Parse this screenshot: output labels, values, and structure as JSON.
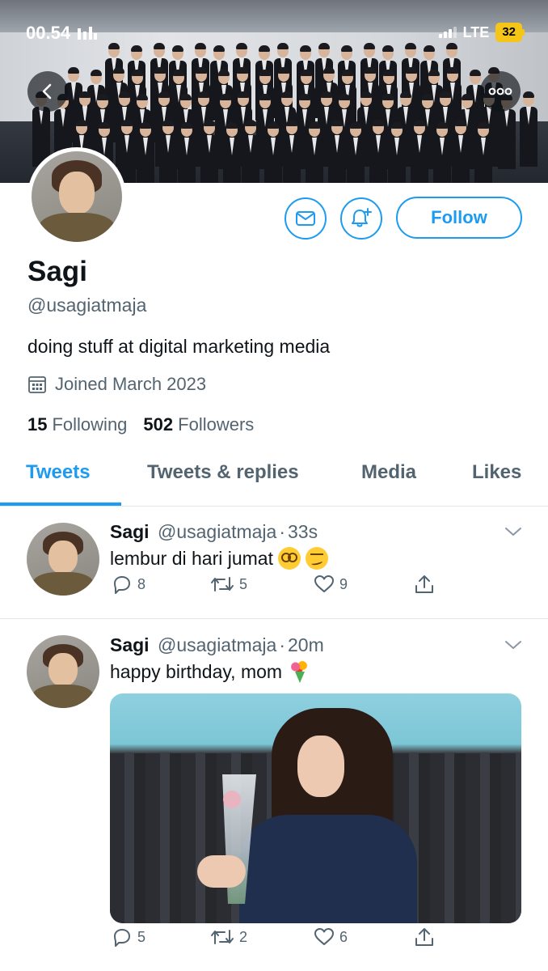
{
  "status_bar": {
    "time": "00.54",
    "network": "LTE",
    "battery": "32"
  },
  "profile": {
    "display_name": "Sagi",
    "handle": "@usagiatmaja",
    "bio": "doing stuff at digital marketing media",
    "joined": "Joined March 2023",
    "following_count": "15",
    "following_label": "Following",
    "followers_count": "502",
    "followers_label": "Followers",
    "follow_label": "Follow"
  },
  "tabs": [
    {
      "label": "Tweets",
      "active": true
    },
    {
      "label": "Tweets & replies",
      "active": false
    },
    {
      "label": "Media",
      "active": false
    },
    {
      "label": "Likes",
      "active": false
    }
  ],
  "tweets": [
    {
      "name": "Sagi",
      "handle": "@usagiatmaja",
      "separator": "·",
      "time": "33s",
      "text": "lembur di hari jumat",
      "emojis": [
        "face-with-spiral-eyes",
        "woozy-face"
      ],
      "replies": "8",
      "retweets": "5",
      "likes": "9"
    },
    {
      "name": "Sagi",
      "handle": "@usagiatmaja",
      "separator": "·",
      "time": "20m",
      "text": "happy birthday, mom",
      "emojis": [
        "bouquet"
      ],
      "replies": "5",
      "retweets": "2",
      "likes": "6",
      "has_media": true
    }
  ],
  "colors": {
    "accent": "#1d9bf0",
    "text_primary": "#0f1419",
    "text_secondary": "#536471",
    "divider": "#e1e8ed"
  }
}
